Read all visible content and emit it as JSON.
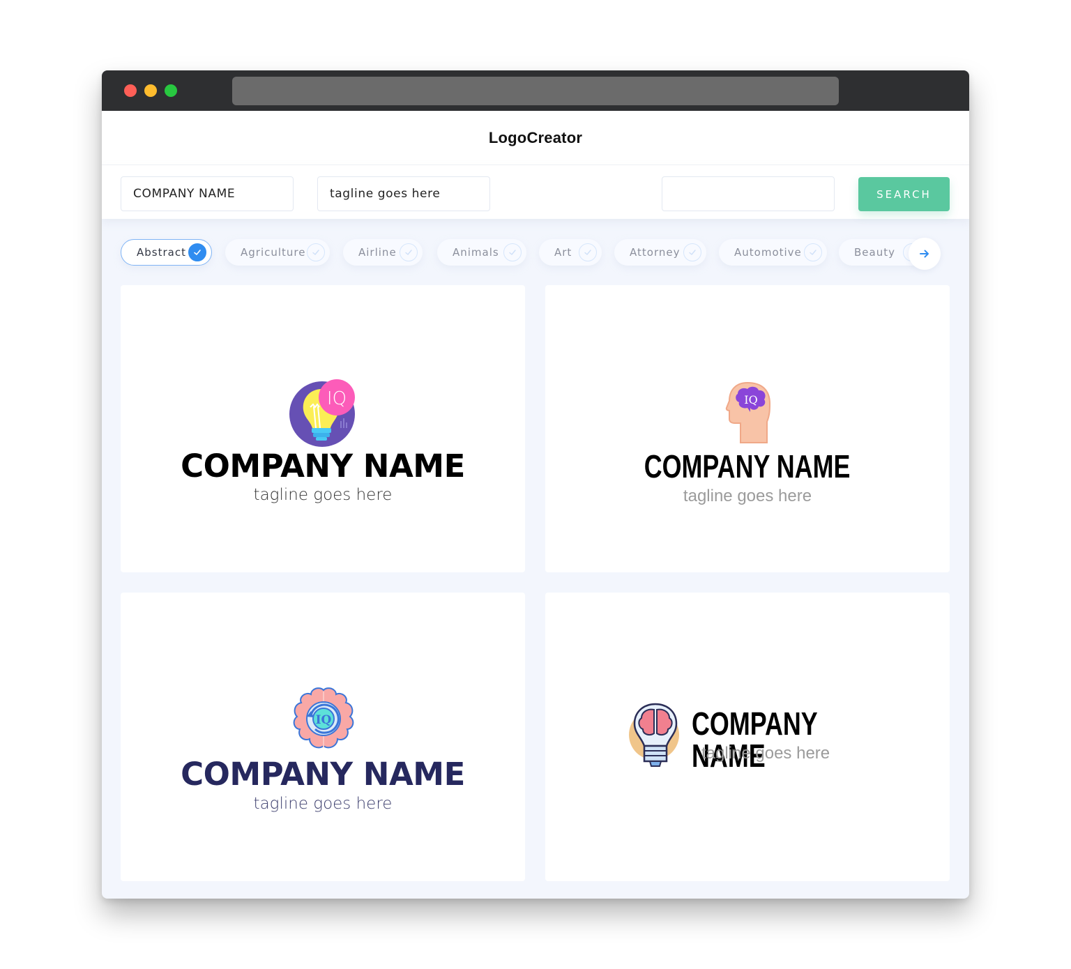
{
  "window": {
    "traffic_lights": [
      "close",
      "minimize",
      "maximize"
    ],
    "url": ""
  },
  "app": {
    "title": "LogoCreator"
  },
  "search": {
    "company_name_value": "COMPANY NAME",
    "tagline_value": "tagline goes here",
    "keyword_value": "",
    "search_label": "SEARCH"
  },
  "categories": {
    "items": [
      {
        "label": "Abstract",
        "selected": true
      },
      {
        "label": "Agriculture",
        "selected": false
      },
      {
        "label": "Airline",
        "selected": false
      },
      {
        "label": "Animals",
        "selected": false
      },
      {
        "label": "Art",
        "selected": false
      },
      {
        "label": "Attorney",
        "selected": false
      },
      {
        "label": "Automotive",
        "selected": false
      },
      {
        "label": "Beauty",
        "selected": false
      }
    ],
    "next_icon": "arrow-right-icon"
  },
  "colors": {
    "accent_blue": "#2f8cf0",
    "search_green": "#5ac89f",
    "navy_text": "#26285e"
  },
  "logos": [
    {
      "icon": "lightbulb-iq-icon",
      "company_name": "COMPANY NAME",
      "tagline": "tagline goes here",
      "name_color": "#000000",
      "tagline_color": "#333333"
    },
    {
      "icon": "head-brain-iq-icon",
      "company_name": "COMPANY NAME",
      "tagline": "tagline goes here",
      "name_color": "#000000",
      "tagline_color": "#9b9b9b"
    },
    {
      "icon": "brain-iq-cycle-icon",
      "company_name": "COMPANY NAME",
      "tagline": "tagline goes here",
      "name_color": "#26285e",
      "tagline_color": "#3d3f6e"
    },
    {
      "icon": "lightbulb-brain-icon",
      "company_name": "COMPANY NAME",
      "tagline": "tagline goes here",
      "name_color": "#000000",
      "tagline_color": "#9b9b9b"
    }
  ]
}
